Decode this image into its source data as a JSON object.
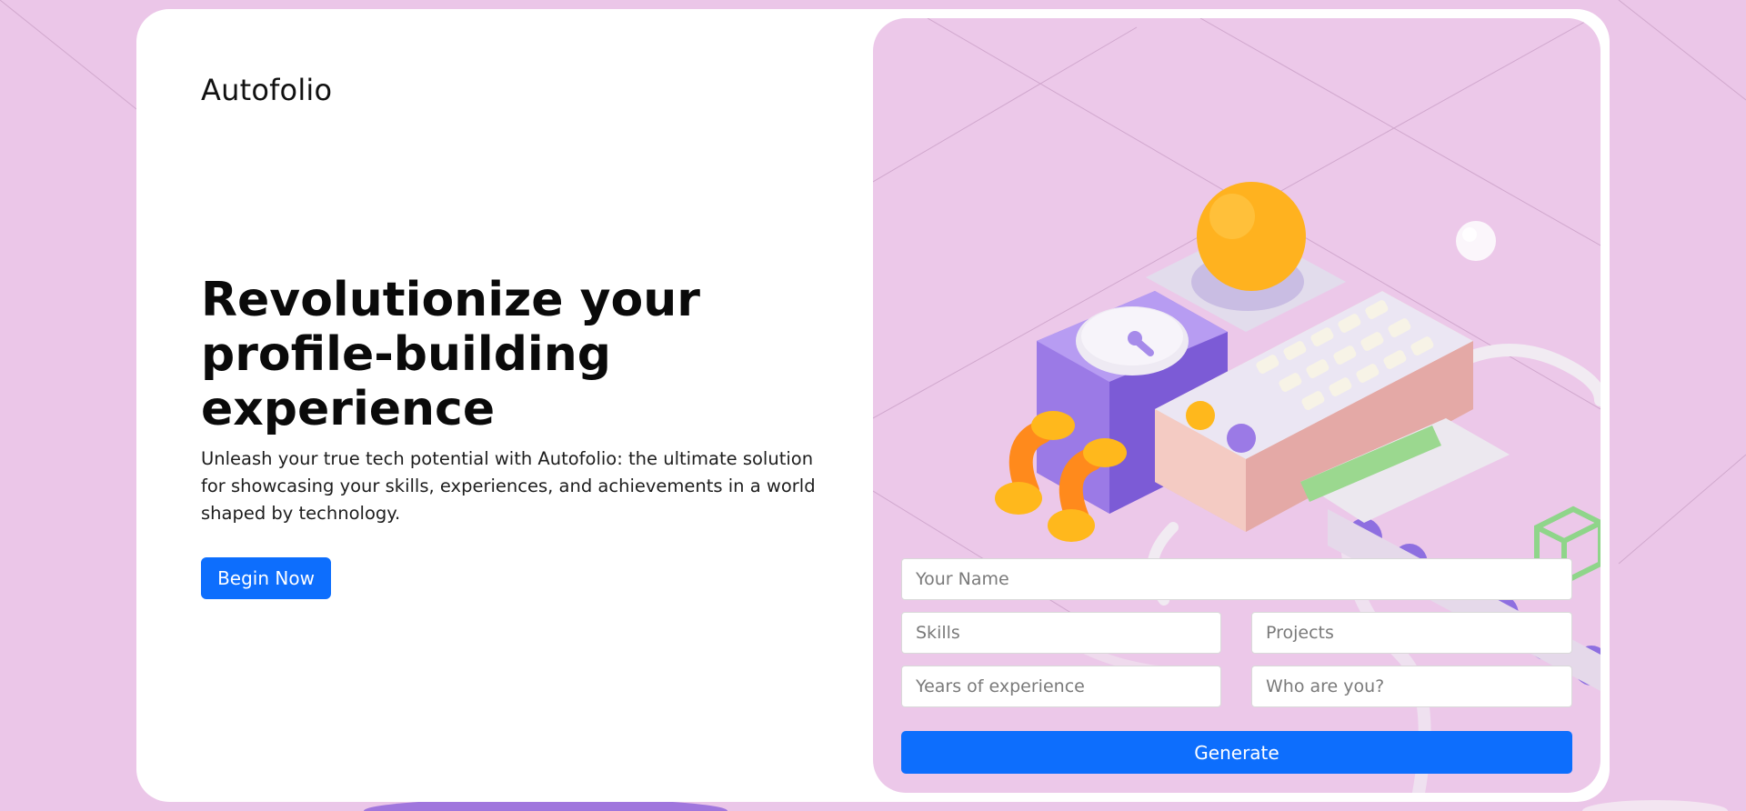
{
  "brand": {
    "logo_text": "Autofolio"
  },
  "hero": {
    "title": "Revolutionize your profile-building experience",
    "subtitle": "Unleash your true tech potential with Autofolio: the ultimate solution for showcasing your skills, experiences, and achievements in a world shaped by technology.",
    "cta_label": "Begin Now"
  },
  "form": {
    "name_placeholder": "Your Name",
    "skills_placeholder": "Skills",
    "projects_placeholder": "Projects",
    "years_placeholder": "Years of experience",
    "who_placeholder": "Who are you?",
    "submit_label": "Generate"
  },
  "colors": {
    "accent": "#0d6efd",
    "background": "#ebc6e8",
    "card": "#ffffff"
  },
  "illustration": {
    "icon": "3d-machine-illustration"
  }
}
